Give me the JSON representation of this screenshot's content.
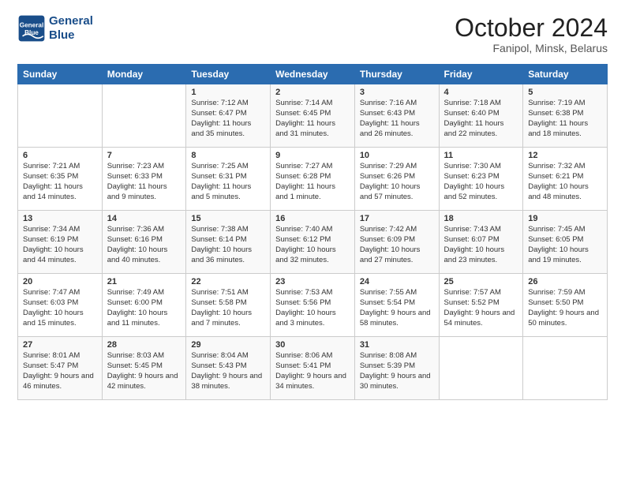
{
  "header": {
    "logo_line1": "General",
    "logo_line2": "Blue",
    "month_title": "October 2024",
    "location": "Fanipol, Minsk, Belarus"
  },
  "days_of_week": [
    "Sunday",
    "Monday",
    "Tuesday",
    "Wednesday",
    "Thursday",
    "Friday",
    "Saturday"
  ],
  "weeks": [
    [
      {
        "day": "",
        "content": ""
      },
      {
        "day": "",
        "content": ""
      },
      {
        "day": "1",
        "content": "Sunrise: 7:12 AM\nSunset: 6:47 PM\nDaylight: 11 hours and 35 minutes."
      },
      {
        "day": "2",
        "content": "Sunrise: 7:14 AM\nSunset: 6:45 PM\nDaylight: 11 hours and 31 minutes."
      },
      {
        "day": "3",
        "content": "Sunrise: 7:16 AM\nSunset: 6:43 PM\nDaylight: 11 hours and 26 minutes."
      },
      {
        "day": "4",
        "content": "Sunrise: 7:18 AM\nSunset: 6:40 PM\nDaylight: 11 hours and 22 minutes."
      },
      {
        "day": "5",
        "content": "Sunrise: 7:19 AM\nSunset: 6:38 PM\nDaylight: 11 hours and 18 minutes."
      }
    ],
    [
      {
        "day": "6",
        "content": "Sunrise: 7:21 AM\nSunset: 6:35 PM\nDaylight: 11 hours and 14 minutes."
      },
      {
        "day": "7",
        "content": "Sunrise: 7:23 AM\nSunset: 6:33 PM\nDaylight: 11 hours and 9 minutes."
      },
      {
        "day": "8",
        "content": "Sunrise: 7:25 AM\nSunset: 6:31 PM\nDaylight: 11 hours and 5 minutes."
      },
      {
        "day": "9",
        "content": "Sunrise: 7:27 AM\nSunset: 6:28 PM\nDaylight: 11 hours and 1 minute."
      },
      {
        "day": "10",
        "content": "Sunrise: 7:29 AM\nSunset: 6:26 PM\nDaylight: 10 hours and 57 minutes."
      },
      {
        "day": "11",
        "content": "Sunrise: 7:30 AM\nSunset: 6:23 PM\nDaylight: 10 hours and 52 minutes."
      },
      {
        "day": "12",
        "content": "Sunrise: 7:32 AM\nSunset: 6:21 PM\nDaylight: 10 hours and 48 minutes."
      }
    ],
    [
      {
        "day": "13",
        "content": "Sunrise: 7:34 AM\nSunset: 6:19 PM\nDaylight: 10 hours and 44 minutes."
      },
      {
        "day": "14",
        "content": "Sunrise: 7:36 AM\nSunset: 6:16 PM\nDaylight: 10 hours and 40 minutes."
      },
      {
        "day": "15",
        "content": "Sunrise: 7:38 AM\nSunset: 6:14 PM\nDaylight: 10 hours and 36 minutes."
      },
      {
        "day": "16",
        "content": "Sunrise: 7:40 AM\nSunset: 6:12 PM\nDaylight: 10 hours and 32 minutes."
      },
      {
        "day": "17",
        "content": "Sunrise: 7:42 AM\nSunset: 6:09 PM\nDaylight: 10 hours and 27 minutes."
      },
      {
        "day": "18",
        "content": "Sunrise: 7:43 AM\nSunset: 6:07 PM\nDaylight: 10 hours and 23 minutes."
      },
      {
        "day": "19",
        "content": "Sunrise: 7:45 AM\nSunset: 6:05 PM\nDaylight: 10 hours and 19 minutes."
      }
    ],
    [
      {
        "day": "20",
        "content": "Sunrise: 7:47 AM\nSunset: 6:03 PM\nDaylight: 10 hours and 15 minutes."
      },
      {
        "day": "21",
        "content": "Sunrise: 7:49 AM\nSunset: 6:00 PM\nDaylight: 10 hours and 11 minutes."
      },
      {
        "day": "22",
        "content": "Sunrise: 7:51 AM\nSunset: 5:58 PM\nDaylight: 10 hours and 7 minutes."
      },
      {
        "day": "23",
        "content": "Sunrise: 7:53 AM\nSunset: 5:56 PM\nDaylight: 10 hours and 3 minutes."
      },
      {
        "day": "24",
        "content": "Sunrise: 7:55 AM\nSunset: 5:54 PM\nDaylight: 9 hours and 58 minutes."
      },
      {
        "day": "25",
        "content": "Sunrise: 7:57 AM\nSunset: 5:52 PM\nDaylight: 9 hours and 54 minutes."
      },
      {
        "day": "26",
        "content": "Sunrise: 7:59 AM\nSunset: 5:50 PM\nDaylight: 9 hours and 50 minutes."
      }
    ],
    [
      {
        "day": "27",
        "content": "Sunrise: 8:01 AM\nSunset: 5:47 PM\nDaylight: 9 hours and 46 minutes."
      },
      {
        "day": "28",
        "content": "Sunrise: 8:03 AM\nSunset: 5:45 PM\nDaylight: 9 hours and 42 minutes."
      },
      {
        "day": "29",
        "content": "Sunrise: 8:04 AM\nSunset: 5:43 PM\nDaylight: 9 hours and 38 minutes."
      },
      {
        "day": "30",
        "content": "Sunrise: 8:06 AM\nSunset: 5:41 PM\nDaylight: 9 hours and 34 minutes."
      },
      {
        "day": "31",
        "content": "Sunrise: 8:08 AM\nSunset: 5:39 PM\nDaylight: 9 hours and 30 minutes."
      },
      {
        "day": "",
        "content": ""
      },
      {
        "day": "",
        "content": ""
      }
    ]
  ]
}
